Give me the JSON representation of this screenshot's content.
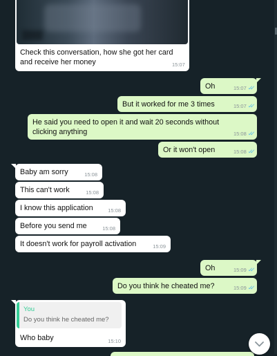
{
  "messages": [
    {
      "id": "m1",
      "side": "in",
      "text": "Check this conversation, how she got her card and receive her money",
      "time": "15:07"
    },
    {
      "id": "m2",
      "side": "out",
      "text": "Oh",
      "time": "15:07"
    },
    {
      "id": "m3",
      "side": "out",
      "text": "But it worked for me 3 times",
      "time": "15:07"
    },
    {
      "id": "m4",
      "side": "out",
      "text": "He said you need to open it and wait 20 seconds without clicking anything",
      "time": "15:08"
    },
    {
      "id": "m5",
      "side": "out",
      "text": "Or it won't open",
      "time": "15:08"
    },
    {
      "id": "m6",
      "side": "in",
      "text": "Baby am sorry",
      "time": "15:08"
    },
    {
      "id": "m7",
      "side": "in",
      "text": "This can't work",
      "time": "15:08"
    },
    {
      "id": "m8",
      "side": "in",
      "text": "I know this application",
      "time": "15:08"
    },
    {
      "id": "m9",
      "side": "in",
      "text": "Before you send me",
      "time": "15:08"
    },
    {
      "id": "m10",
      "side": "in",
      "text": "It doesn't work for payroll activation",
      "time": "15:09"
    },
    {
      "id": "m11",
      "side": "out",
      "text": "Oh",
      "time": "15:09"
    },
    {
      "id": "m12",
      "side": "out",
      "text": "Do you think he cheated me?",
      "time": "15:09"
    },
    {
      "id": "m13",
      "side": "in",
      "text": "Who baby",
      "time": "15:10",
      "quote": {
        "author": "You",
        "text": "Do you think he cheated me?"
      }
    }
  ],
  "icons": {
    "read_receipt": "double-check-icon",
    "scroll_down": "chevron-down-icon"
  },
  "colors": {
    "background": "#162228",
    "incoming_bubble": "#ffffff",
    "outgoing_bubble": "#dcf8c6",
    "read_tick": "#4fb6ec",
    "quote_accent": "#35cd96"
  }
}
